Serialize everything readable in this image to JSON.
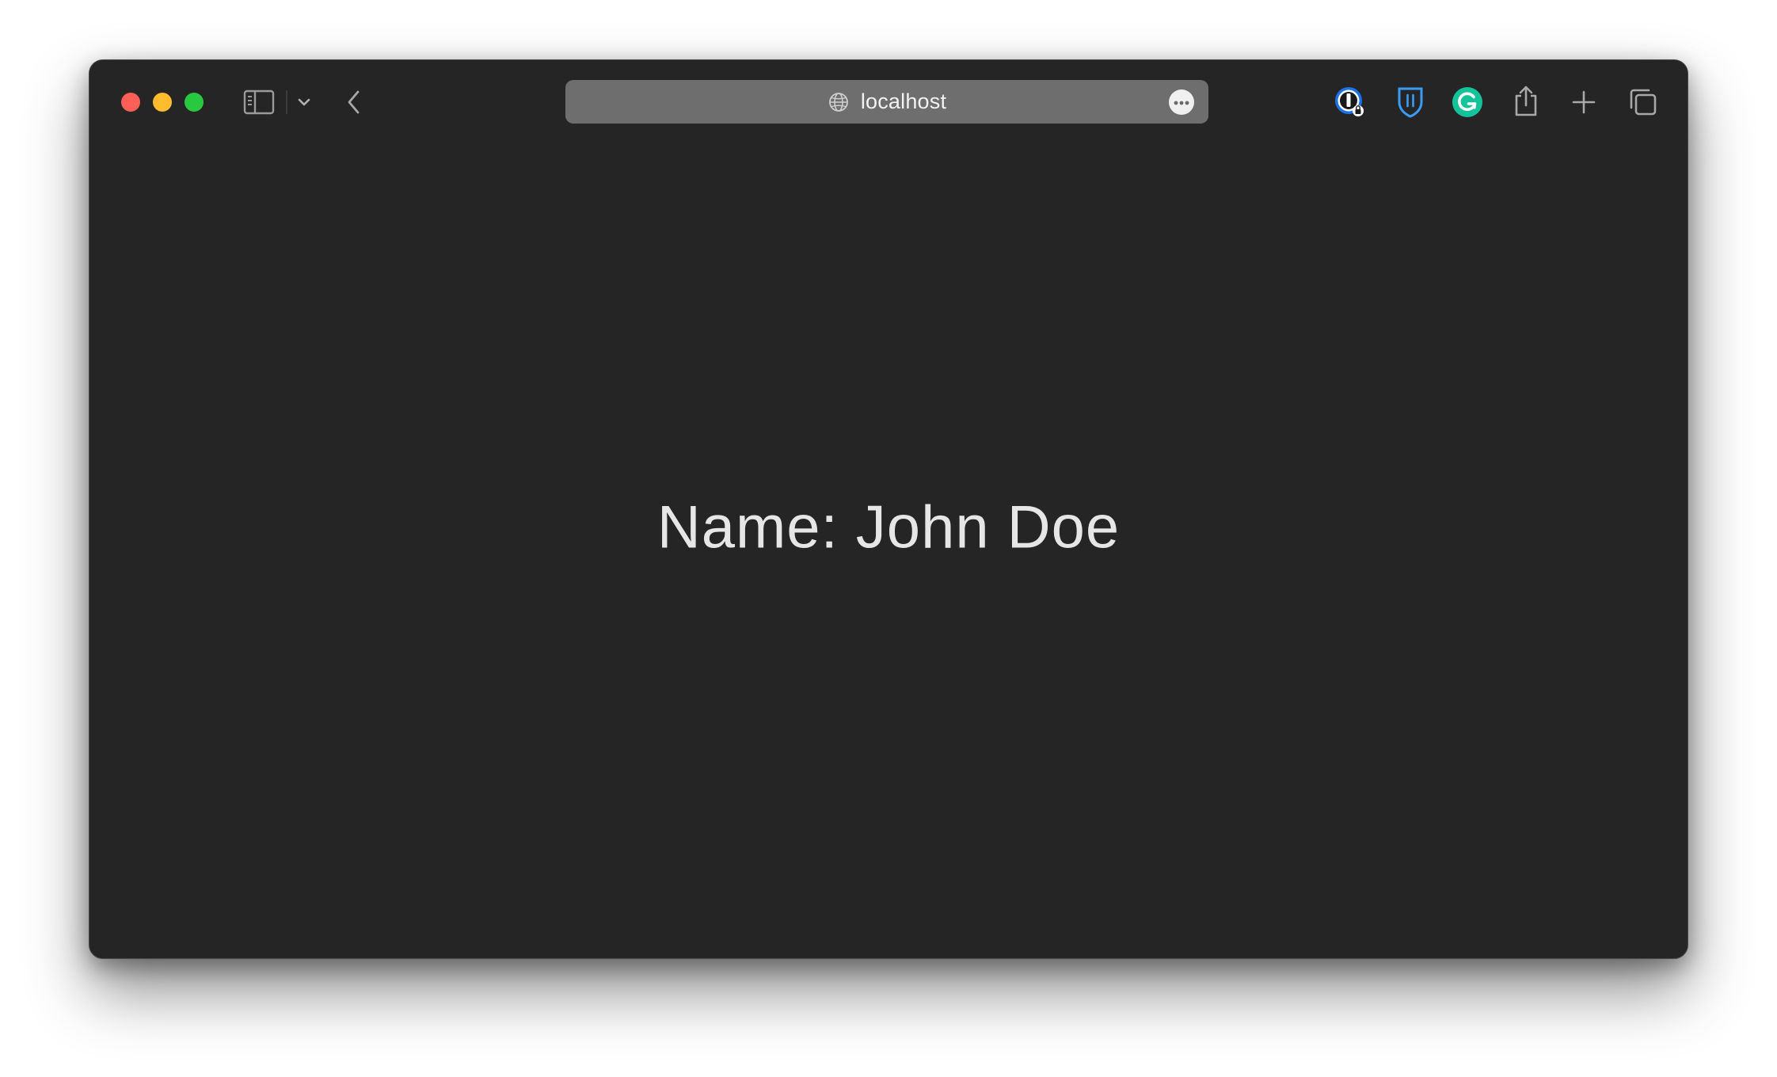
{
  "browser": {
    "address_bar": {
      "url_text": "localhost"
    },
    "toolbar_icons": {
      "sidebar": "sidebar-icon",
      "tab_group_menu": "chevron-down-icon",
      "back": "chevron-left-icon",
      "page_menu": "ellipsis-icon",
      "extensions": [
        "1password-icon",
        "bitwarden-icon",
        "grammarly-icon"
      ],
      "share": "share-icon",
      "new_tab": "plus-icon",
      "tab_overview": "tabs-icon"
    },
    "colors": {
      "window_background": "#252525",
      "address_bar": "#6e6e6e",
      "close": "#ff5f57",
      "minimize": "#febc2e",
      "maximize": "#28c840",
      "bitwarden": "#3b82f6",
      "grammarly": "#15c39a"
    }
  },
  "page": {
    "text": "Name: John Doe"
  }
}
